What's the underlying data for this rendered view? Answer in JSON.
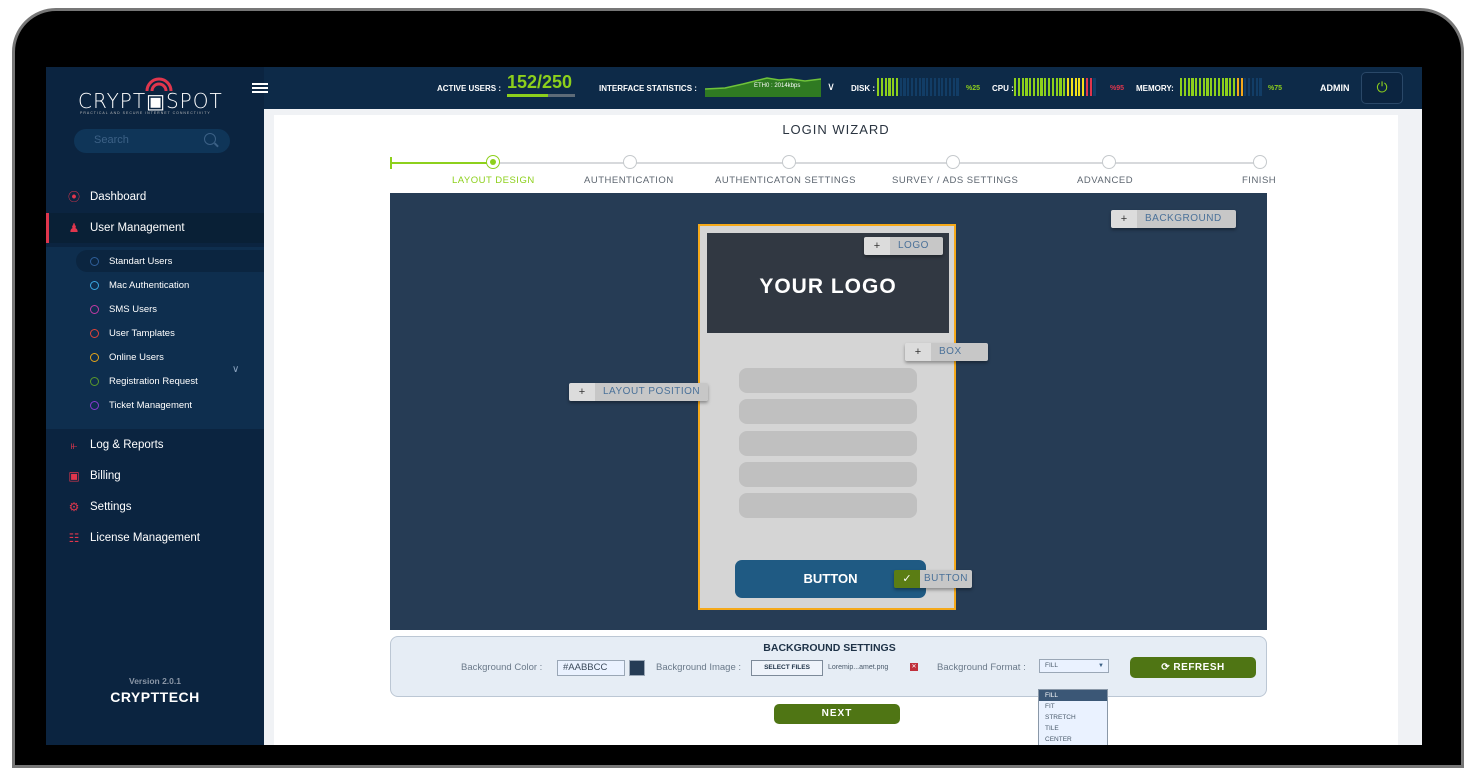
{
  "app": {
    "logo_text": "CRYPT▣SPOT",
    "logo_tagline": "PRACTICAL AND SECURE INTERNET CONNECTIVITY",
    "brand_footer": "CRYPTTECH",
    "version": "Version 2.0.1"
  },
  "sidebar": {
    "search_placeholder": "Search",
    "items": [
      {
        "label": "Dashboard",
        "icon": "dashboard-icon",
        "glyph": "⦿"
      },
      {
        "label": "User Management",
        "icon": "user-gear-icon",
        "glyph": "♟",
        "active": true
      },
      {
        "label": "Log & Reports",
        "icon": "chart-icon",
        "glyph": "⫦"
      },
      {
        "label": "Billing",
        "icon": "billing-icon",
        "glyph": "▣"
      },
      {
        "label": "Settings",
        "icon": "gear-icon",
        "glyph": "⚙"
      },
      {
        "label": "License Management",
        "icon": "license-icon",
        "glyph": "☷"
      }
    ],
    "sub_items": [
      {
        "label": "Standart Users",
        "color": "#2f5f9a",
        "selected": true
      },
      {
        "label": "Mac Authentication",
        "color": "#3aa7e0"
      },
      {
        "label": "SMS Users",
        "color": "#c23ba5"
      },
      {
        "label": "User Tamplates",
        "color": "#e0443a"
      },
      {
        "label": "Online Users",
        "color": "#e5a419"
      },
      {
        "label": "Registration Request",
        "color": "#5a9a2a"
      },
      {
        "label": "Ticket Management",
        "color": "#8a3ad0"
      }
    ]
  },
  "topbar": {
    "active_users_label": "ACTIVE USERS :",
    "active_users_value": "152/250",
    "active_users_fraction": 0.608,
    "interface_label": "INTERFACE STATISTICS :",
    "interface_value": "ETH0 : 2014kbps",
    "disk_label": "DISK :",
    "disk_pct": "%25",
    "disk_fraction": 0.25,
    "cpu_label": "CPU :",
    "cpu_pct": "%95",
    "cpu_fraction": 0.95,
    "memory_label": "MEMORY:",
    "memory_pct": "%75",
    "memory_fraction": 0.75,
    "user": "ADMIN",
    "colors": {
      "green": "#8dd01c",
      "yellow": "#f2e01a",
      "orange": "#f5a91a",
      "red": "#e0364d",
      "empty": "#123d66"
    }
  },
  "wizard": {
    "title": "LOGIN WIZARD",
    "steps": [
      "LAYOUT DESIGN",
      "AUTHENTICATION",
      "AUTHENTICATON SETTINGS",
      "SURVEY / ADS SETTINGS",
      "ADVANCED",
      "FINISH"
    ],
    "current_step": 0
  },
  "preview": {
    "logo_placeholder": "YOUR LOGO",
    "button_text": "BUTTON",
    "tags": {
      "background": "BACKGROUND",
      "logo": "LOGO",
      "box": "BOX",
      "layout_position": "LAYOUT POSITION",
      "button": "BUTTON"
    },
    "plus": "+",
    "check": "✓"
  },
  "background_settings": {
    "title": "BACKGROUND SETTINGS",
    "color_label": "Background Color :",
    "color_value": "#AABBCC",
    "image_label": "Background Image :",
    "select_files": "SELECT FILES",
    "file_name": "Loremip...amet.png",
    "format_label": "Background Format :",
    "format_value": "FILL",
    "format_options": [
      "FILL",
      "FIT",
      "STRETCH",
      "TILE",
      "CENTER"
    ],
    "refresh": "⟳ REFRESH"
  },
  "next_label": "NEXT"
}
